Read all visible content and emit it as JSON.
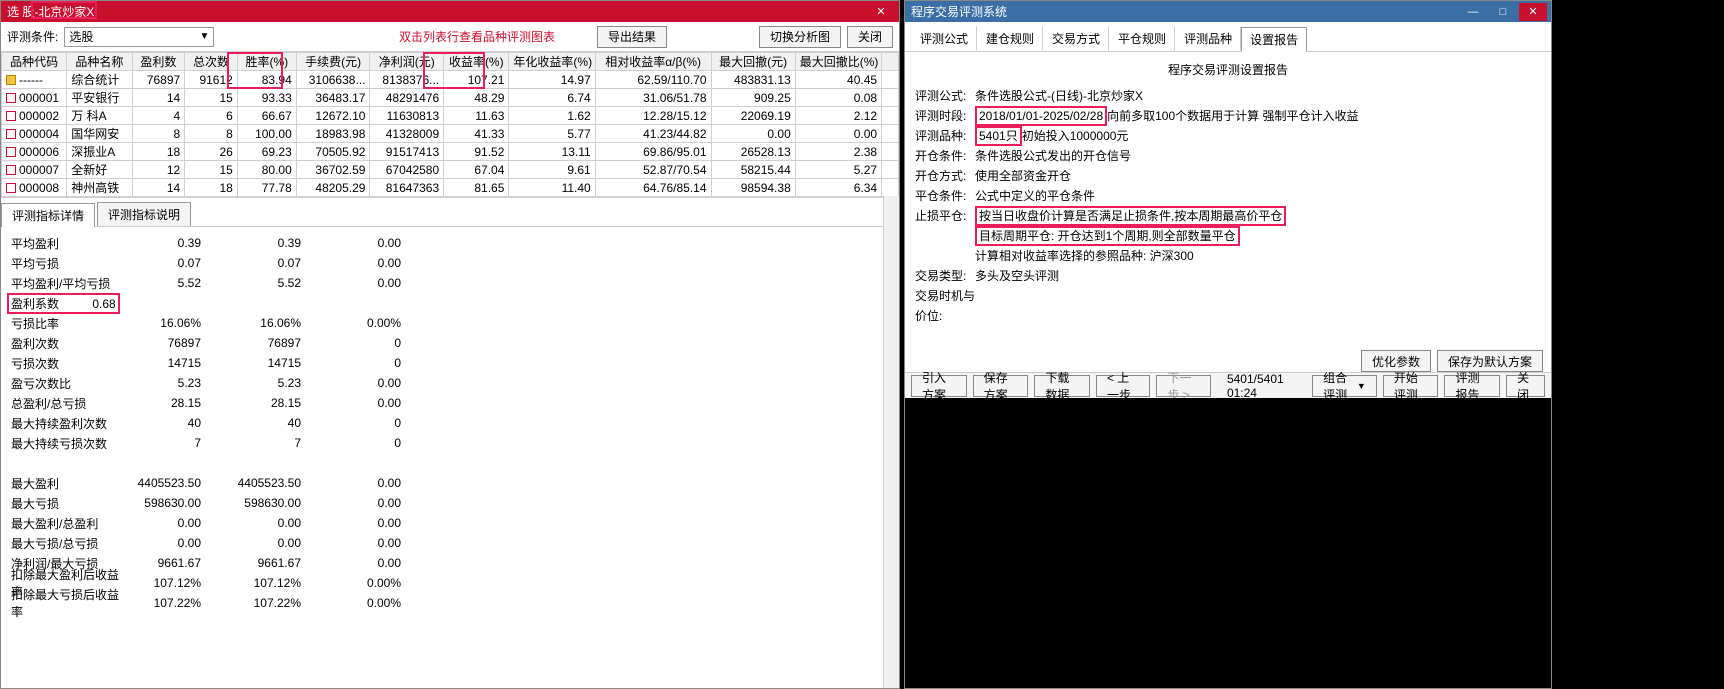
{
  "left": {
    "title": "选 股-北京炒家X",
    "toolbar": {
      "condition_label": "评测条件:",
      "condition_value": "选股",
      "hint": "双击列表行查看品种评测图表",
      "export_btn": "导出结果",
      "switch_btn": "切换分析图",
      "close_btn": "关闭"
    },
    "columns": [
      "品种代码",
      "品种名称",
      "盈利数",
      "总次数",
      "胜率(%)",
      "手续费(元)",
      "净利润(元)",
      "收益率(%)",
      "年化收益率(%)",
      "相对收益率α/β(%)",
      "最大回撤(元)",
      "最大回撤比(%)"
    ],
    "rows": [
      {
        "code": "------",
        "name": "综合统计",
        "c": [
          "76897",
          "91612",
          "83.94",
          "3106638...",
          "8138376...",
          "107.21",
          "14.97",
          "62.59/110.70",
          "483831.13",
          "40.45"
        ]
      },
      {
        "code": "000001",
        "name": "平安银行",
        "c": [
          "14",
          "15",
          "93.33",
          "36483.17",
          "48291476",
          "48.29",
          "6.74",
          "31.06/51.78",
          "909.25",
          "0.08"
        ]
      },
      {
        "code": "000002",
        "name": "万 科A",
        "c": [
          "4",
          "6",
          "66.67",
          "12672.10",
          "11630813",
          "11.63",
          "1.62",
          "12.28/15.12",
          "22069.19",
          "2.12"
        ]
      },
      {
        "code": "000004",
        "name": "国华网安",
        "c": [
          "8",
          "8",
          "100.00",
          "18983.98",
          "41328009",
          "41.33",
          "5.77",
          "41.23/44.82",
          "0.00",
          "0.00"
        ]
      },
      {
        "code": "000006",
        "name": "深振业A",
        "c": [
          "18",
          "26",
          "69.23",
          "70505.92",
          "91517413",
          "91.52",
          "13.11",
          "69.86/95.01",
          "26528.13",
          "2.38"
        ]
      },
      {
        "code": "000007",
        "name": "全新好",
        "c": [
          "12",
          "15",
          "80.00",
          "36702.59",
          "67042580",
          "67.04",
          "9.61",
          "52.87/70.54",
          "58215.44",
          "5.27"
        ]
      },
      {
        "code": "000008",
        "name": "神州高铁",
        "c": [
          "14",
          "18",
          "77.78",
          "48205.29",
          "81647363",
          "81.65",
          "11.40",
          "64.76/85.14",
          "98594.38",
          "6.34"
        ]
      }
    ],
    "tabs": {
      "detail": "评测指标详情",
      "desc": "评测指标说明"
    },
    "metrics": [
      {
        "label": "平均盈利",
        "v1": "0.39",
        "v2": "0.39",
        "v3": "0.00"
      },
      {
        "label": "平均亏损",
        "v1": "0.07",
        "v2": "0.07",
        "v3": "0.00"
      },
      {
        "label": "平均盈利/平均亏损",
        "v1": "5.52",
        "v2": "5.52",
        "v3": "0.00"
      },
      {
        "label": "盈利系数",
        "v1": "0.68",
        "v2": "",
        "v3": "",
        "hl": true
      },
      {
        "label": "亏损比率",
        "v1": "16.06%",
        "v2": "16.06%",
        "v3": "0.00%"
      },
      {
        "label": "盈利次数",
        "v1": "76897",
        "v2": "76897",
        "v3": "0"
      },
      {
        "label": "亏损次数",
        "v1": "14715",
        "v2": "14715",
        "v3": "0"
      },
      {
        "label": "盈亏次数比",
        "v1": "5.23",
        "v2": "5.23",
        "v3": "0.00"
      },
      {
        "label": "总盈利/总亏损",
        "v1": "28.15",
        "v2": "28.15",
        "v3": "0.00"
      },
      {
        "label": "最大持续盈利次数",
        "v1": "40",
        "v2": "40",
        "v3": "0"
      },
      {
        "label": "最大持续亏损次数",
        "v1": "7",
        "v2": "7",
        "v3": "0"
      },
      {
        "label": "",
        "v1": "",
        "v2": "",
        "v3": ""
      },
      {
        "label": "最大盈利",
        "v1": "4405523.50",
        "v2": "4405523.50",
        "v3": "0.00"
      },
      {
        "label": "最大亏损",
        "v1": "598630.00",
        "v2": "598630.00",
        "v3": "0.00"
      },
      {
        "label": "最大盈利/总盈利",
        "v1": "0.00",
        "v2": "0.00",
        "v3": "0.00"
      },
      {
        "label": "最大亏损/总亏损",
        "v1": "0.00",
        "v2": "0.00",
        "v3": "0.00"
      },
      {
        "label": "净利润/最大亏损",
        "v1": "9661.67",
        "v2": "9661.67",
        "v3": "0.00"
      },
      {
        "label": "扣除最大盈利后收益率",
        "v1": "107.12%",
        "v2": "107.12%",
        "v3": "0.00%"
      },
      {
        "label": "扣除最大亏损后收益率",
        "v1": "107.22%",
        "v2": "107.22%",
        "v3": "0.00%"
      }
    ]
  },
  "right": {
    "title": "程序交易评测系统",
    "ctrls": {
      "min": "—",
      "max": "□",
      "close": "✕"
    },
    "tabs": [
      "评测公式",
      "建仓规则",
      "交易方式",
      "平仓规则",
      "评测品种",
      "设置报告"
    ],
    "active_tab": 5,
    "report": {
      "title": "程序交易评测设置报告",
      "lines": [
        {
          "key": "评测公式:",
          "val": "条件选股公式-(日线)-北京炒家X"
        },
        {
          "key": "评测时段:",
          "val": "2018/01/01-2025/02/28",
          "after": "向前多取100个数据用于计算 强制平仓计入收益",
          "box": true
        },
        {
          "key": "评测品种:",
          "val": "5401只",
          "after": "初始投入1000000元",
          "box": true
        },
        {
          "key": "开仓条件:",
          "val": "条件选股公式发出的开仓信号"
        },
        {
          "key": "开仓方式:",
          "val": "使用全部资金开仓"
        },
        {
          "key": "平仓条件:",
          "val": "公式中定义的平仓条件"
        },
        {
          "key": "止损平仓:",
          "val": "按当日收盘价计算是否满足止损条件,按本周期最高价平仓",
          "box": true
        },
        {
          "key": "",
          "val": "目标周期平仓: 开仓达到1个周期,则全部数量平仓",
          "box": true,
          "indent": true
        },
        {
          "key": "",
          "val": "计算相对收益率选择的参照品种:  沪深300",
          "indent": true
        },
        {
          "key": "",
          "val": ""
        },
        {
          "key": "交易类型:",
          "val": "多头及空头评测"
        },
        {
          "key": "交易时机与价位:",
          "val": ""
        }
      ]
    },
    "footer_btns": {
      "opt": "优化参数",
      "save_default": "保存为默认方案"
    },
    "status": {
      "import": "引入方案",
      "save": "保存方案",
      "download": "下载数据",
      "prev": "< 上一步",
      "next": "下一步 >",
      "progress": "5401/5401  01:24",
      "combo": "组合评测",
      "start": "开始评测",
      "report": "评测报告",
      "close": "关闭"
    }
  }
}
